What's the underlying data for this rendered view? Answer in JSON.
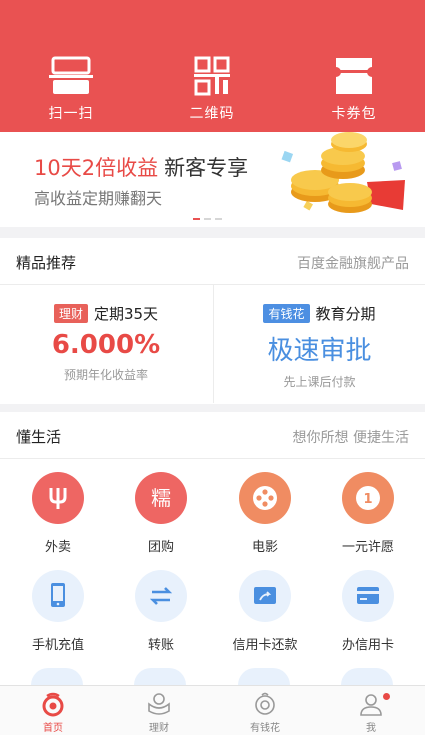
{
  "header": {
    "actions": [
      {
        "label": "扫一扫",
        "icon": "scan-icon"
      },
      {
        "label": "二维码",
        "icon": "qrcode-icon"
      },
      {
        "label": "卡券包",
        "icon": "coupon-icon"
      }
    ]
  },
  "banner": {
    "title_accent": "10天2倍收益",
    "title_rest": "新客专享",
    "subtitle": "高收益定期赚翻天",
    "pages": 3,
    "active_page": 1
  },
  "featured": {
    "title": "精品推荐",
    "extra": "百度金融旗舰产品",
    "products": [
      {
        "tag": "理财",
        "name": "定期35天",
        "value": "6.000%",
        "desc": "预期年化收益率"
      },
      {
        "tag": "有钱花",
        "name": "教育分期",
        "value": "极速审批",
        "desc": "先上课后付款"
      }
    ]
  },
  "life": {
    "title": "懂生活",
    "extra": "想你所想 便捷生活",
    "items": [
      {
        "label": "外卖",
        "icon": "fork-icon",
        "color": "#ee6663"
      },
      {
        "label": "团购",
        "icon": "nuo-icon",
        "color": "#ee6663",
        "glyph": "糯"
      },
      {
        "label": "电影",
        "icon": "film-reel-icon",
        "color": "#f08c62"
      },
      {
        "label": "一元许愿",
        "icon": "coin-one-icon",
        "color": "#f08c62",
        "glyph": "1"
      },
      {
        "label": "手机充值",
        "icon": "phone-icon",
        "color": "#e8f1fc"
      },
      {
        "label": "转账",
        "icon": "transfer-icon",
        "color": "#e8f1fc"
      },
      {
        "label": "信用卡还款",
        "icon": "card-repay-icon",
        "color": "#e8f1fc"
      },
      {
        "label": "办信用卡",
        "icon": "credit-card-icon",
        "color": "#e8f1fc"
      }
    ]
  },
  "tabbar": {
    "tabs": [
      {
        "label": "首页",
        "icon": "home-icon",
        "active": true
      },
      {
        "label": "理财",
        "icon": "wealth-icon",
        "active": false
      },
      {
        "label": "有钱花",
        "icon": "loan-icon",
        "active": false
      },
      {
        "label": "我",
        "icon": "profile-icon",
        "active": false,
        "badge": true
      }
    ]
  },
  "colors": {
    "brand_red": "#e95252",
    "accent_blue": "#4a8fe0"
  }
}
